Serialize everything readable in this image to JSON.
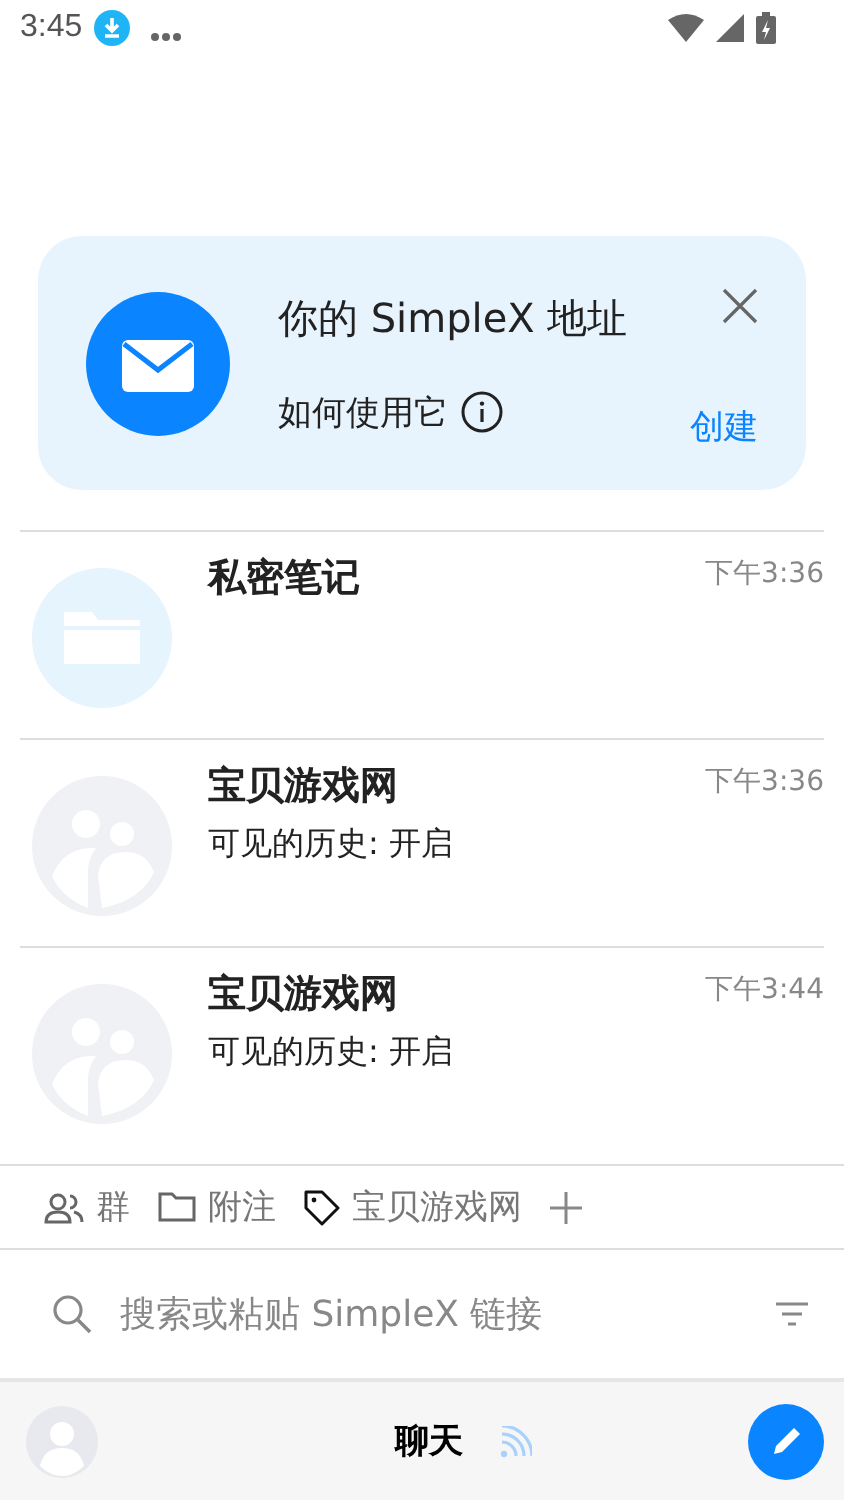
{
  "status_bar": {
    "time": "3:45"
  },
  "address_card": {
    "title": "你的 SimpleX 地址",
    "link": "如何使用它",
    "action": "创建"
  },
  "chats": [
    {
      "kind": "notes",
      "name": "私密笔记",
      "time": "下午3:36"
    },
    {
      "kind": "group",
      "name": "宝贝游戏网",
      "preview": "可见的历史: 开启",
      "time": "下午3:36"
    },
    {
      "kind": "group",
      "name": "宝贝游戏网",
      "preview": "可见的历史: 开启",
      "time": "下午3:44"
    }
  ],
  "filters": [
    {
      "kind": "groups",
      "label": "群"
    },
    {
      "kind": "notes",
      "label": "附注"
    },
    {
      "kind": "tag",
      "label": "宝贝游戏网"
    }
  ],
  "search": {
    "placeholder": "搜索或粘贴 SimpleX 链接"
  },
  "bottom_bar": {
    "title": "聊天"
  }
}
